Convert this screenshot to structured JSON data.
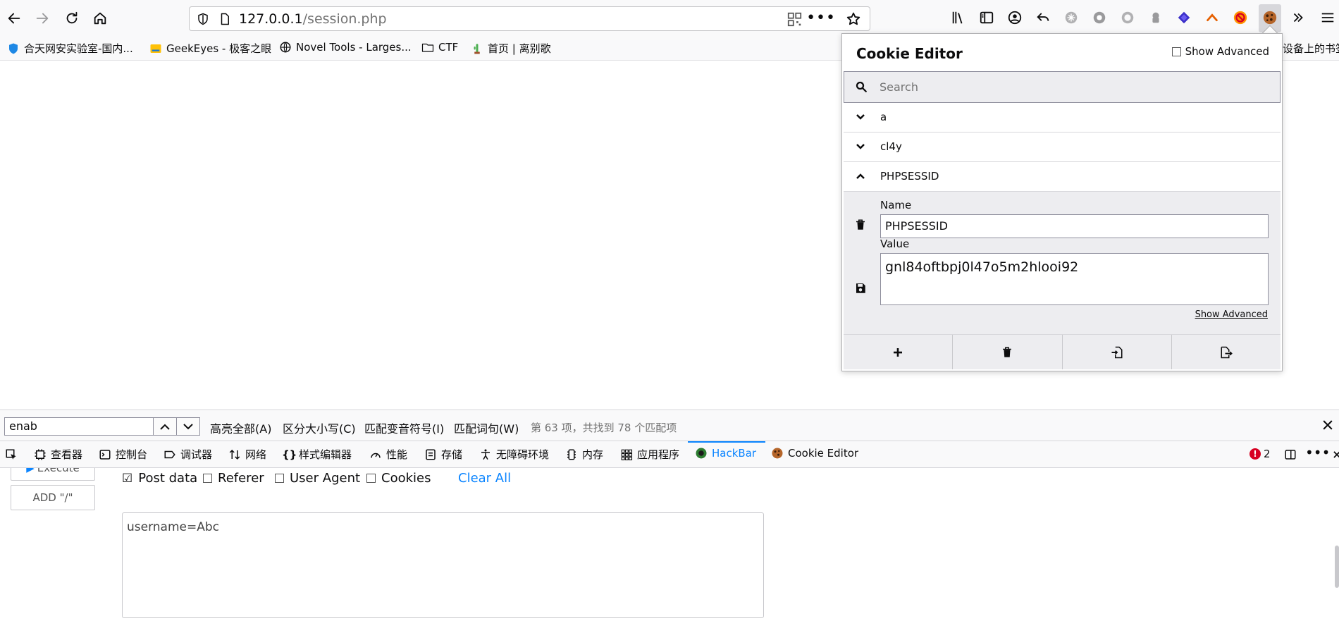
{
  "browser": {
    "url_host": "127.0.0.1",
    "url_path": "/session.php",
    "url_more": "•••"
  },
  "bookmarks": [
    {
      "label": "合天网安实验室-国内..."
    },
    {
      "label": "GeekEyes - 极客之眼"
    },
    {
      "label": "Novel Tools - Larges..."
    },
    {
      "label": "CTF"
    },
    {
      "label": "首页 | 离别歌"
    },
    {
      "label": "移动设备上的书签"
    }
  ],
  "cookie_editor": {
    "title": "Cookie Editor",
    "show_advanced": "Show Advanced",
    "search_placeholder": "Search",
    "cookies": [
      {
        "name": "a"
      },
      {
        "name": "cl4y"
      },
      {
        "name": "PHPSESSID"
      }
    ],
    "detail": {
      "name_label": "Name",
      "name_value": "PHPSESSID",
      "value_label": "Value",
      "value_value": "gnl84oftbpj0l47o5m2hlooi92",
      "show_advanced_link": "Show Advanced"
    }
  },
  "findbar": {
    "query": "enab",
    "highlight_all": "高亮全部(A)",
    "match_case": "区分大小写(C)",
    "match_diacritics": "匹配变音符号(I)",
    "whole_words": "匹配词句(W)",
    "status": "第 63 项，共找到 78 个匹配项"
  },
  "devtools": {
    "tabs": [
      {
        "label": "查看器"
      },
      {
        "label": "控制台"
      },
      {
        "label": "调试器"
      },
      {
        "label": "网络"
      },
      {
        "label": "样式编辑器"
      },
      {
        "label": "性能"
      },
      {
        "label": "存储"
      },
      {
        "label": "无障碍环境"
      },
      {
        "label": "内存"
      },
      {
        "label": "应用程序"
      },
      {
        "label": "HackBar"
      },
      {
        "label": "Cookie Editor"
      }
    ],
    "error_count": "2",
    "active_color": "#0a84ff"
  },
  "hackbar": {
    "execute_label": "Execute",
    "add_slash_label": "ADD \"/\"",
    "options": [
      {
        "label": "Post data",
        "checked": true
      },
      {
        "label": "Referer",
        "checked": false
      },
      {
        "label": "User Agent",
        "checked": false
      },
      {
        "label": "Cookies",
        "checked": false
      }
    ],
    "clear_all": "Clear All",
    "post_body": "username=Abc"
  }
}
